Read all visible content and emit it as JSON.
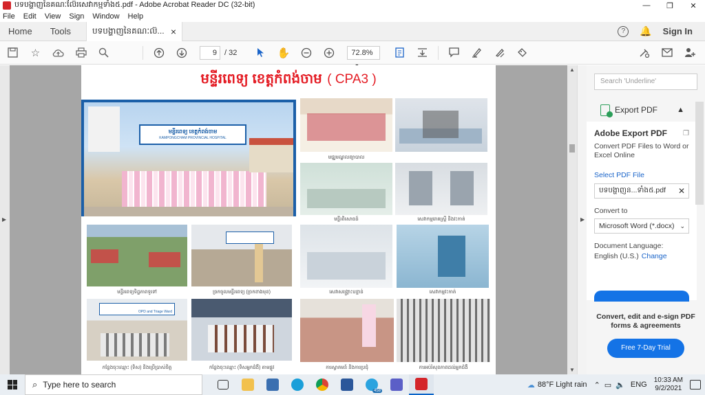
{
  "window": {
    "title": "បទបង្ហាញនៃគណៈល៊ែរសេវាកម្មទាំង៥.pdf - Adobe Acrobat Reader DC (32-bit)",
    "min": "—",
    "max": "❐",
    "close": "✕"
  },
  "menu": [
    "File",
    "Edit",
    "View",
    "Sign",
    "Window",
    "Help"
  ],
  "tabs": {
    "home": "Home",
    "tools": "Tools",
    "doc": "បទបង្ហាញនៃគណៈល៊...",
    "close": "×",
    "help": "?",
    "signin": "Sign In"
  },
  "toolbar": {
    "page_current": "9",
    "page_total": "/ 32",
    "zoom": "72.8%"
  },
  "pdf": {
    "title_kh": "មន្ទីរពេទ្យ ខេត្តកំពង់ចាម",
    "title_code": "( CPA3 )",
    "sign_line1": "មន្ទីរពេទ្យ ខេត្តកំពង់ចាម",
    "sign_line2": "KAMPONGCHAM PROVINCIAL HOSPITAL",
    "captions": [
      "មជ្ឈមណ្ឌលព្យាបាល",
      "មន្ទីរពិសោធន៍",
      "សេវាកម្មរោគស្ត្រី និងវះកាត់",
      "មន្ទីរពេទ្យទិដ្ឋភាពទូទៅ",
      "ច្រកចូលមន្ទីរពេទ្យ (ច្រកខាងមុខ)",
      "សេវាសង្គ្រោះបន្ទាន់",
      "សេវាកម្មវះកាត់",
      "កន្លែងចុះឈ្មោះ (ទិស) និងប្រើប្រាស់ចិត្ត",
      "កន្លែងចុះឈ្មោះ (ទិសអ្នកជំងឺ) តាមផ្លូវ",
      "ការស្វាគមន៍ និងការប្រជុំ",
      "ការអប់រំសុខភាពដល់អ្នកជំងឺ"
    ],
    "opd_sign": "OPD and Triage Ward"
  },
  "right_pane": {
    "search_placeholder": "Search 'Underline'",
    "export_header": "Export PDF",
    "adobe_export_title": "Adobe Export PDF",
    "adobe_export_desc": "Convert PDF Files to Word or Excel Online",
    "select_file": "Select PDF File",
    "file_name": "បទបង្ហាញន...ទាំង៥.pdf",
    "convert_to": "Convert to",
    "convert_value": "Microsoft Word (*.docx)",
    "doc_lang_label": "Document Language:",
    "doc_lang_value": "English (U.S.)",
    "change": "Change",
    "promo": "Convert, edit and e-sign PDF forms & agreements",
    "trial": "Free 7-Day Trial"
  },
  "taskbar": {
    "search_placeholder": "Type here to search",
    "weather": "88°F  Light rain",
    "lang": "ENG",
    "time": "10:33 AM",
    "date": "9/2/2021",
    "teams_badge": "458"
  },
  "colors": {
    "accent": "#1473e6",
    "acrobat_red": "#d4252a",
    "title_red": "#e41b23",
    "frame_blue": "#1b5fa8"
  }
}
